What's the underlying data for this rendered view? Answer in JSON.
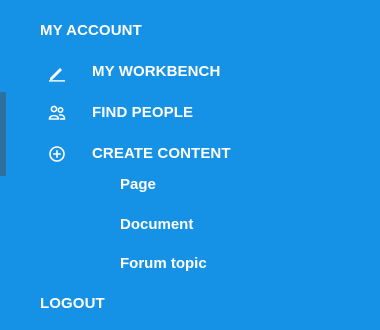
{
  "menu": {
    "account_label": "MY ACCOUNT",
    "items": [
      {
        "label": "MY WORKBENCH",
        "icon": "pencil-icon"
      },
      {
        "label": "FIND PEOPLE",
        "icon": "people-icon"
      },
      {
        "label": "CREATE CONTENT",
        "icon": "plus-circle-icon"
      }
    ],
    "create_content_submenu": [
      {
        "label": "Page"
      },
      {
        "label": "Document"
      },
      {
        "label": "Forum topic"
      }
    ],
    "logout_label": "LOGOUT"
  },
  "colors": {
    "panel_background": "#1592e6",
    "text": "#ffffff",
    "left_edge": "#2d6f9f"
  }
}
